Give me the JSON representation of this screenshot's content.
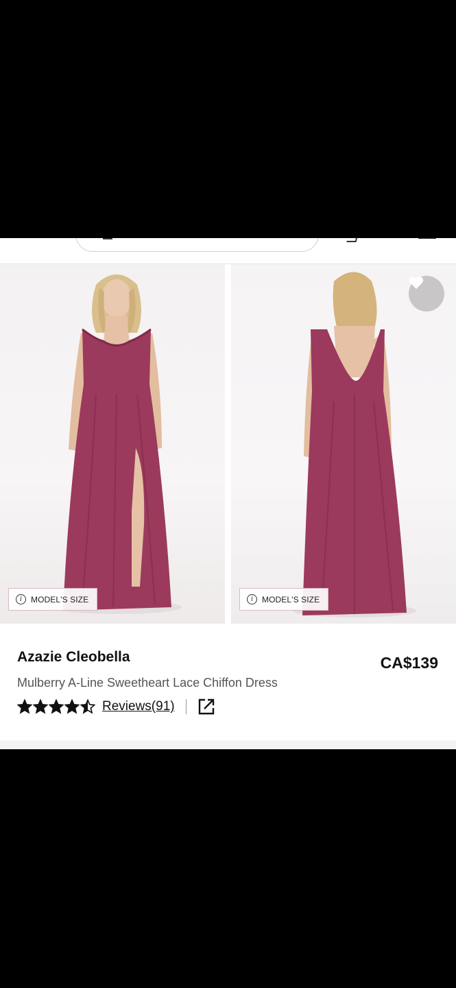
{
  "gallery": {
    "images": [
      {
        "tag_label": "MODEL'S SIZE"
      },
      {
        "tag_label": "MODEL'S SIZE"
      }
    ]
  },
  "product": {
    "brand": "Azazie Cleobella",
    "description": "Mulberry A-Line Sweetheart Lace Chiffon Dress",
    "price": "CA$139",
    "rating": 4.5,
    "reviews_label": "Reviews(91)"
  },
  "icons": {
    "favorite": "heart-icon",
    "info": "info-icon",
    "share": "external-link-icon",
    "star": "star-icon"
  },
  "colors": {
    "dress": "#9b3a5c",
    "text": "#111111",
    "muted_text": "#555555",
    "fav_bg": "#c9c6c7"
  }
}
